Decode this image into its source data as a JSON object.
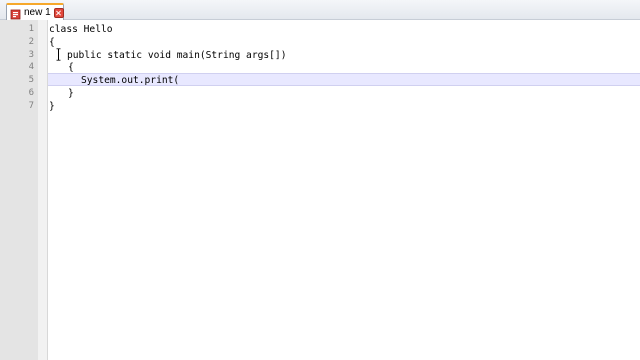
{
  "tab": {
    "label": "new 1",
    "icon": "file-icon",
    "close_icon": "close-icon"
  },
  "editor": {
    "lines": [
      {
        "number": "1",
        "text": "class Hello"
      },
      {
        "number": "2",
        "text": "{"
      },
      {
        "number": "3",
        "text": "public static void main(String args[])"
      },
      {
        "number": "4",
        "text": "{"
      },
      {
        "number": "5",
        "text": "System.out.print("
      },
      {
        "number": "6",
        "text": "}"
      },
      {
        "number": "7",
        "text": "}"
      }
    ],
    "current_line": "5"
  },
  "colors": {
    "current_line_highlight": "#e8e8ff",
    "gutter": "#e4e4e4",
    "tab_accent": "#f6a82b",
    "close_button": "#e2483c"
  }
}
